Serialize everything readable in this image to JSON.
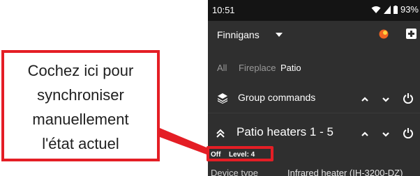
{
  "statusbar": {
    "time": "10:51",
    "battery": "93%"
  },
  "appbar": {
    "site_name": "Finnigans",
    "icons": [
      "chevron-down-icon",
      "weather-icon",
      "add-icon"
    ]
  },
  "tabs": [
    {
      "label": "All",
      "active": false
    },
    {
      "label": "Fireplace",
      "active": false
    },
    {
      "label": "Patio",
      "active": true
    }
  ],
  "group_row": {
    "label": "Group commands",
    "icons": [
      "layers-icon",
      "chevron-up-icon",
      "chevron-down-icon",
      "power-icon"
    ]
  },
  "heater_row": {
    "label": "Patio heaters 1 - 5",
    "status": "Off",
    "level": "Level: 4",
    "icons": [
      "collapse-icon",
      "chevron-up-icon",
      "chevron-down-icon",
      "power-icon"
    ]
  },
  "detail_row": {
    "label": "Device type",
    "value": "Infrared heater (IH-3200-DZ)"
  },
  "annotation": {
    "lines": [
      "Cochez ici pour",
      "synchroniser",
      "manuellement",
      "l'état actuel"
    ],
    "accent_color": "#e41e25"
  },
  "colors": {
    "background": "#2f2f2f",
    "statusbar": "#141414",
    "weather_accent": "#f26522"
  }
}
